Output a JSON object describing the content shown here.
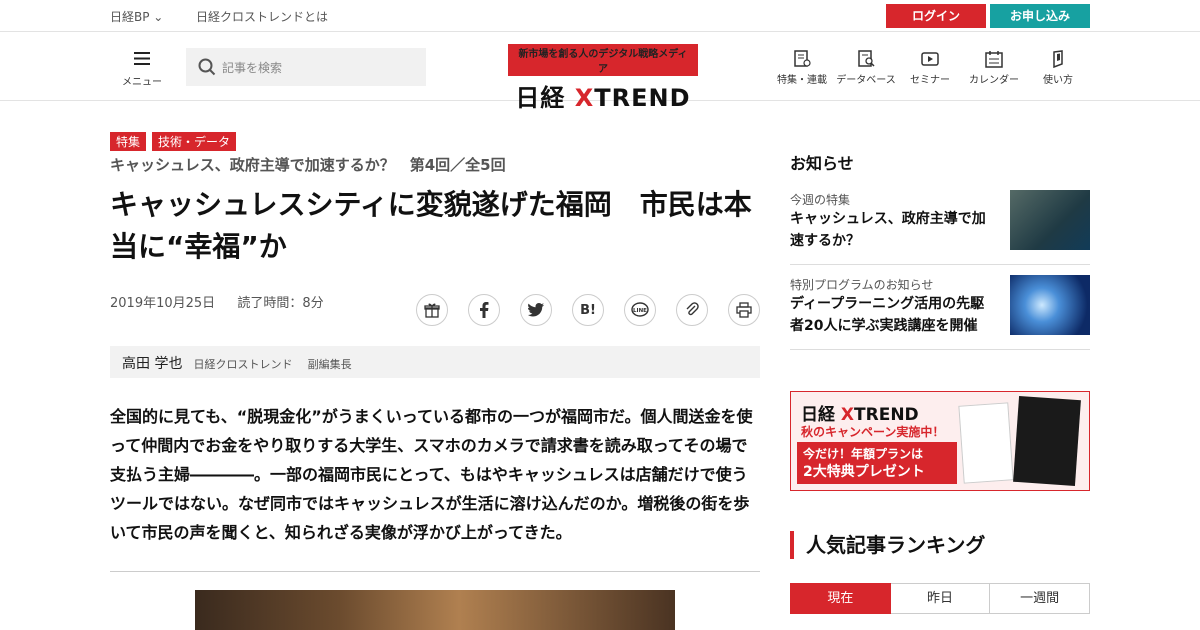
{
  "topbar": {
    "brand": "日経BP",
    "about": "日経クロストレンドとは",
    "login": "ログイン",
    "apply": "お申し込み"
  },
  "header": {
    "menu_label": "メニュー",
    "search_placeholder": "記事を検索",
    "tagline": "新市場を創る人のデジタル戦略メディア",
    "logo_main": "日経 ",
    "logo_x": "X",
    "logo_rest": "TREND",
    "nav": [
      {
        "label": "特集・連載",
        "icon": "feature-icon"
      },
      {
        "label": "データベース",
        "icon": "database-icon"
      },
      {
        "label": "セミナー",
        "icon": "seminar-icon"
      },
      {
        "label": "カレンダー",
        "icon": "calendar-icon"
      },
      {
        "label": "使い方",
        "icon": "guide-icon"
      }
    ]
  },
  "article": {
    "tags": [
      "特集",
      "技術・データ"
    ],
    "series": "キャッシュレス、政府主導で加速するか？　第4回／全5回",
    "title": "キャッシュレスシティに変貌遂げた福岡　市民は本当に“幸福”か",
    "date": "2019年10月25日",
    "read_time": "読了時間：8分",
    "author_name": "高田 学也",
    "author_org": "日経クロストレンド",
    "author_role": "副編集長",
    "lede": "全国的に見ても、“脱現金化”がうまくいっている都市の一つが福岡市だ。個人間送金を使って仲間内でお金をやり取りする大学生、スマホのカメラで請求書を読み取ってその場で支払う主婦――――。一部の福岡市民にとって、もはやキャッシュレスは店舗だけで使うツールではない。なぜ同市ではキャッシュレスが生活に溶け込んだのか。増税後の街を歩いて市民の声を聞くと、知られざる実像が浮かび上がってきた。",
    "share_b": "B!"
  },
  "sidebar": {
    "notice_heading": "お知らせ",
    "notices": [
      {
        "category": "今週の特集",
        "text": "キャッシュレス、政府主導で加速するか？"
      },
      {
        "category": "特別プログラムのお知らせ",
        "text": "ディープラーニング活用の先駆者20人に学ぶ実践講座を開催"
      }
    ],
    "banner": {
      "logo_main": "日経 ",
      "logo_x": "X",
      "logo_rest": "TREND",
      "campaign": "秋のキャンペーン実施中！",
      "offer_line1": "今だけ！年額プランは",
      "offer_line2": "2大特典プレゼント"
    },
    "ranking_heading": "人気記事ランキング",
    "ranking_tabs": [
      "現在",
      "昨日",
      "一週間"
    ]
  },
  "colors": {
    "accent": "#d7262c",
    "teal": "#17a1a1"
  }
}
